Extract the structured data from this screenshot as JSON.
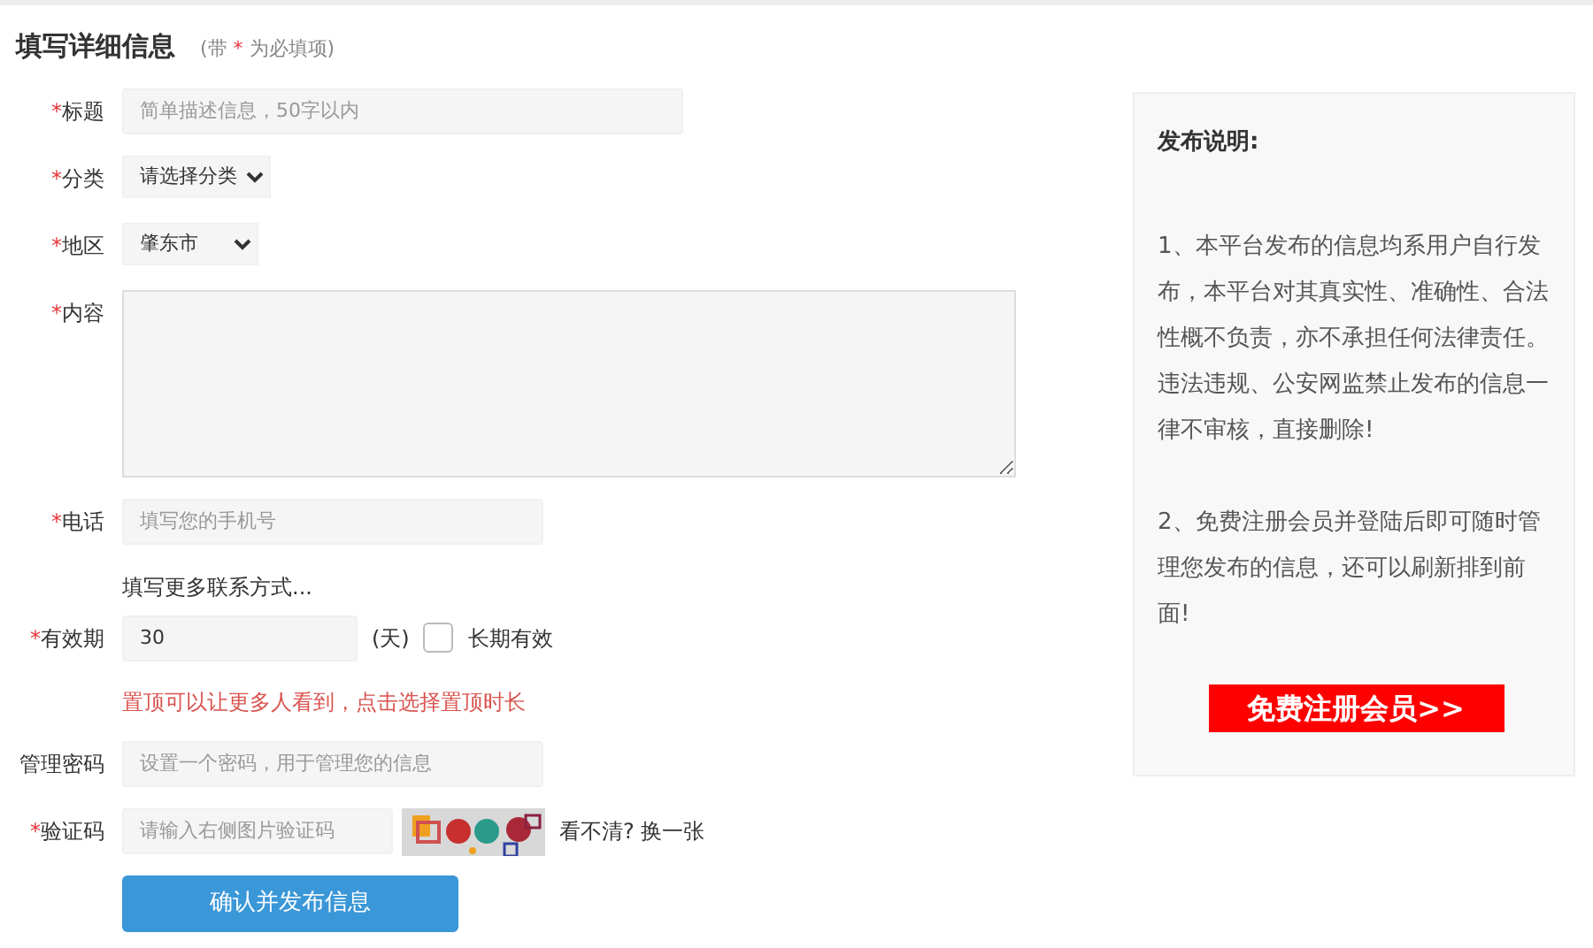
{
  "header": {
    "title": "填写详细信息",
    "hint": {
      "before": "(带",
      "mark": "*",
      "after": "为必填项)"
    }
  },
  "fields": [
    {
      "kind": "line",
      "mark": "*",
      "label": "标题",
      "placeholder": "简单描述信息，50字以内"
    },
    {
      "kind": "select",
      "mark": "*",
      "label": "分类",
      "value": "请选择分类"
    },
    {
      "kind": "select",
      "mark": "*",
      "label": "地区",
      "value": "肇东市"
    },
    {
      "kind": "textarea",
      "mark": "*",
      "label": "内容"
    },
    {
      "kind": "text",
      "mark": "*",
      "label": "电话",
      "placeholder": "填写您的手机号"
    },
    {
      "kind": "link",
      "text": "填写更多联系方式..."
    },
    {
      "kind": "validity",
      "mark": "*",
      "label": "有效期",
      "value": "30",
      "unit": "(天)",
      "checkbox_label": "长期有效",
      "checked": false
    },
    {
      "kind": "notice",
      "text": "置顶可以让更多人看到，点击选择置顶时长"
    },
    {
      "kind": "text",
      "label": "管理密码",
      "placeholder": "设置一个密码，用于管理您的信息"
    },
    {
      "kind": "captcha",
      "mark": "*",
      "label": "验证码",
      "placeholder": "请输入右侧图片验证码",
      "refresh": "看不清? 换一张"
    }
  ],
  "submit": "确认并发布信息",
  "sidebar": {
    "title": "发布说明:",
    "paragraphs": [
      "1、本平台发布的信息均系用户自行发布，本平台对其真实性、准确性、合法性概不负责，亦不承担任何法律责任。违法违规、公安网监禁止发布的信息一律不审核，直接删除!",
      "2、免费注册会员并登陆后即可随时管理您发布的信息，还可以刷新排到前面!"
    ],
    "register_button": "免费注册会员>>"
  }
}
